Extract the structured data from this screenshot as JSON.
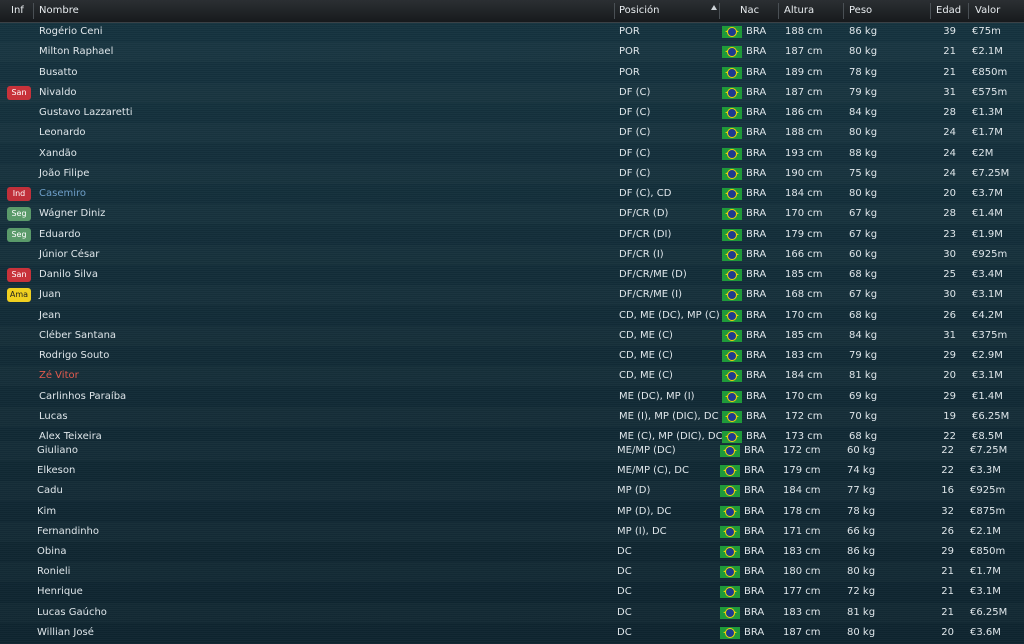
{
  "header": {
    "inf": "Inf",
    "nombre": "Nombre",
    "posicion": "Posición",
    "nac": "Nac",
    "altura": "Altura",
    "peso": "Peso",
    "edad": "Edad",
    "valor": "Valor"
  },
  "players": [
    {
      "badge": "",
      "name": "Rogério Ceni",
      "pos": "POR",
      "nat": "BRA",
      "height": "188 cm",
      "weight": "86 kg",
      "age": "39",
      "value": "€75m"
    },
    {
      "badge": "",
      "name": "Milton Raphael",
      "pos": "POR",
      "nat": "BRA",
      "height": "187 cm",
      "weight": "80 kg",
      "age": "21",
      "value": "€2.1M"
    },
    {
      "badge": "",
      "name": "Busatto",
      "pos": "POR",
      "nat": "BRA",
      "height": "189 cm",
      "weight": "78 kg",
      "age": "21",
      "value": "€850m"
    },
    {
      "badge": "San",
      "name": "Nivaldo",
      "pos": "DF (C)",
      "nat": "BRA",
      "height": "187 cm",
      "weight": "79 kg",
      "age": "31",
      "value": "€575m"
    },
    {
      "badge": "",
      "name": "Gustavo Lazzaretti",
      "pos": "DF (C)",
      "nat": "BRA",
      "height": "186 cm",
      "weight": "84 kg",
      "age": "28",
      "value": "€1.3M"
    },
    {
      "badge": "",
      "name": "Leonardo",
      "pos": "DF (C)",
      "nat": "BRA",
      "height": "188 cm",
      "weight": "80 kg",
      "age": "24",
      "value": "€1.7M"
    },
    {
      "badge": "",
      "name": "Xandão",
      "pos": "DF (C)",
      "nat": "BRA",
      "height": "193 cm",
      "weight": "88 kg",
      "age": "24",
      "value": "€2M"
    },
    {
      "badge": "",
      "name": "João Filipe",
      "pos": "DF (C)",
      "nat": "BRA",
      "height": "190 cm",
      "weight": "75 kg",
      "age": "24",
      "value": "€7.25M"
    },
    {
      "badge": "Ind",
      "name": "Casemiro",
      "pos": "DF (C), CD",
      "nat": "BRA",
      "height": "184 cm",
      "weight": "80 kg",
      "age": "20",
      "value": "€3.7M",
      "style": "injured"
    },
    {
      "badge": "Seg",
      "name": "Wágner Diniz",
      "pos": "DF/CR (D)",
      "nat": "BRA",
      "height": "170 cm",
      "weight": "67 kg",
      "age": "28",
      "value": "€1.4M"
    },
    {
      "badge": "Seg",
      "name": "Eduardo",
      "pos": "DF/CR (DI)",
      "nat": "BRA",
      "height": "179 cm",
      "weight": "67 kg",
      "age": "23",
      "value": "€1.9M"
    },
    {
      "badge": "",
      "name": "Júnior César",
      "pos": "DF/CR (I)",
      "nat": "BRA",
      "height": "166 cm",
      "weight": "60 kg",
      "age": "30",
      "value": "€925m"
    },
    {
      "badge": "San",
      "name": "Danilo Silva",
      "pos": "DF/CR/ME (D)",
      "nat": "BRA",
      "height": "185 cm",
      "weight": "68 kg",
      "age": "25",
      "value": "€3.4M"
    },
    {
      "badge": "Ama",
      "name": "Juan",
      "pos": "DF/CR/ME (I)",
      "nat": "BRA",
      "height": "168 cm",
      "weight": "67 kg",
      "age": "30",
      "value": "€3.1M"
    },
    {
      "badge": "",
      "name": "Jean",
      "pos": "CD, ME (DC), MP (C)",
      "nat": "BRA",
      "height": "170 cm",
      "weight": "68 kg",
      "age": "26",
      "value": "€4.2M"
    },
    {
      "badge": "",
      "name": "Cléber Santana",
      "pos": "CD, ME (C)",
      "nat": "BRA",
      "height": "185 cm",
      "weight": "84 kg",
      "age": "31",
      "value": "€375m"
    },
    {
      "badge": "",
      "name": "Rodrigo Souto",
      "pos": "CD, ME (C)",
      "nat": "BRA",
      "height": "183 cm",
      "weight": "79 kg",
      "age": "29",
      "value": "€2.9M"
    },
    {
      "badge": "",
      "name": "Zé Vitor",
      "pos": "CD, ME (C)",
      "nat": "BRA",
      "height": "184 cm",
      "weight": "81 kg",
      "age": "20",
      "value": "€3.1M",
      "style": "hot"
    },
    {
      "badge": "",
      "name": "Carlinhos Paraíba",
      "pos": "ME (DC), MP (I)",
      "nat": "BRA",
      "height": "170 cm",
      "weight": "69 kg",
      "age": "29",
      "value": "€1.4M"
    },
    {
      "badge": "",
      "name": "Lucas",
      "pos": "ME (I), MP (DIC), DC",
      "nat": "BRA",
      "height": "172 cm",
      "weight": "70 kg",
      "age": "19",
      "value": "€6.25M"
    },
    {
      "badge": "",
      "name": "Alex Teixeira",
      "pos": "ME (C), MP (DIC), DC",
      "nat": "BRA",
      "height": "173 cm",
      "weight": "68 kg",
      "age": "22",
      "value": "€8.5M"
    },
    {
      "badge": "",
      "name": "Giuliano",
      "pos": "ME/MP (DC)",
      "nat": "BRA",
      "height": "172 cm",
      "weight": "60 kg",
      "age": "22",
      "value": "€7.25M"
    },
    {
      "badge": "",
      "name": "Elkeson",
      "pos": "ME/MP (C), DC",
      "nat": "BRA",
      "height": "179 cm",
      "weight": "74 kg",
      "age": "22",
      "value": "€3.3M"
    },
    {
      "badge": "",
      "name": "Cadu",
      "pos": "MP (D)",
      "nat": "BRA",
      "height": "184 cm",
      "weight": "77 kg",
      "age": "16",
      "value": "€925m"
    },
    {
      "badge": "",
      "name": "Kim",
      "pos": "MP (D), DC",
      "nat": "BRA",
      "height": "178 cm",
      "weight": "78 kg",
      "age": "32",
      "value": "€875m"
    },
    {
      "badge": "",
      "name": "Fernandinho",
      "pos": "MP (I), DC",
      "nat": "BRA",
      "height": "171 cm",
      "weight": "66 kg",
      "age": "26",
      "value": "€2.1M"
    },
    {
      "badge": "",
      "name": "Obina",
      "pos": "DC",
      "nat": "BRA",
      "height": "183 cm",
      "weight": "86 kg",
      "age": "29",
      "value": "€850m"
    },
    {
      "badge": "",
      "name": "Ronieli",
      "pos": "DC",
      "nat": "BRA",
      "height": "180 cm",
      "weight": "80 kg",
      "age": "21",
      "value": "€1.7M"
    },
    {
      "badge": "",
      "name": "Henrique",
      "pos": "DC",
      "nat": "BRA",
      "height": "177 cm",
      "weight": "72 kg",
      "age": "21",
      "value": "€3.1M"
    },
    {
      "badge": "",
      "name": "Lucas Gaúcho",
      "pos": "DC",
      "nat": "BRA",
      "height": "183 cm",
      "weight": "81 kg",
      "age": "21",
      "value": "€6.25M"
    },
    {
      "badge": "",
      "name": "Willian José",
      "pos": "DC",
      "nat": "BRA",
      "height": "187 cm",
      "weight": "80 kg",
      "age": "20",
      "value": "€3.6M"
    }
  ]
}
